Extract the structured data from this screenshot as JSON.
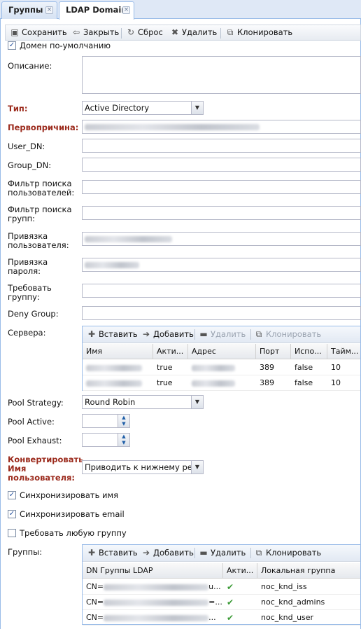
{
  "tabs": [
    {
      "label": "Группы",
      "close": "×"
    },
    {
      "label": "LDAP Domain",
      "close": "×"
    }
  ],
  "toolbar": {
    "save": "Сохранить",
    "close": "Закрыть",
    "reset": "Сброс",
    "delete": "Удалить",
    "clone": "Клонировать"
  },
  "form": {
    "default_domain_label": "Домен по-умолчанию",
    "default_domain_checked": true,
    "description_label": "Описание:",
    "type_label": "Тип:",
    "type_value": "Active Directory",
    "root_label": "Первопричина:",
    "user_dn_label": "User_DN:",
    "group_dn_label": "Group_DN:",
    "user_filter_label_1": "Фильтр поиска",
    "user_filter_label_2": "пользователей:",
    "group_filter_label_1": "Фильтр поиска",
    "group_filter_label_2": "групп:",
    "user_bind_label_1": "Привязка",
    "user_bind_label_2": "пользователя:",
    "password_bind_label_1": "Привязка",
    "password_bind_label_2": "пароля:",
    "require_group_label_1": "Требовать",
    "require_group_label_2": "группу:",
    "deny_group_label": "Deny Group:",
    "servers_label": "Сервера:",
    "pool_strategy_label": "Pool Strategy:",
    "pool_strategy_value": "Round Robin",
    "pool_active_label": "Pool Active:",
    "pool_exhaust_label": "Pool Exhaust:",
    "convert_label_1": "Конвертировать",
    "convert_label_2": "Имя",
    "convert_label_3": "пользователя:",
    "convert_value": "Приводить к нижнему рег",
    "sync_name_label": "Синхронизировать имя",
    "sync_email_label": "Синхронизировать email",
    "require_any_group_label": "Требовать любую группу",
    "groups_label": "Группы:"
  },
  "grid_toolbar": {
    "insert": "Вставить",
    "add": "Добавить",
    "delete": "Удалить",
    "clone": "Клонировать"
  },
  "servers_grid": {
    "columns": [
      "Имя",
      "Акти...",
      "Адрес",
      "Порт",
      "Испо...",
      "Тайм..."
    ],
    "rows": [
      {
        "active": "true",
        "port": "389",
        "used": "false",
        "timeout": "10"
      },
      {
        "active": "true",
        "port": "389",
        "used": "false",
        "timeout": "10"
      }
    ]
  },
  "groups_grid": {
    "columns": [
      "DN Группы LDAP",
      "Акти...",
      "Локальная группа"
    ],
    "rows": [
      {
        "dn_prefix": "CN=",
        "dn_suffix": "u...",
        "local": "noc_knd_iss"
      },
      {
        "dn_prefix": "CN=",
        "dn_suffix": "=...",
        "local": "noc_knd_admins"
      },
      {
        "dn_prefix": "CN=",
        "dn_suffix": "...",
        "local": "noc_knd_user"
      }
    ]
  },
  "colors": {
    "required_label": "#9b2a1c",
    "panel_border": "#99bbe8",
    "check_green": "#3a9a35"
  },
  "icons": [
    "save-icon",
    "close-icon",
    "reset-icon",
    "delete-icon",
    "clone-icon",
    "plus-icon",
    "add-icon",
    "minus-icon",
    "chevron-down-icon",
    "spinner-icon",
    "checkmark-icon"
  ]
}
